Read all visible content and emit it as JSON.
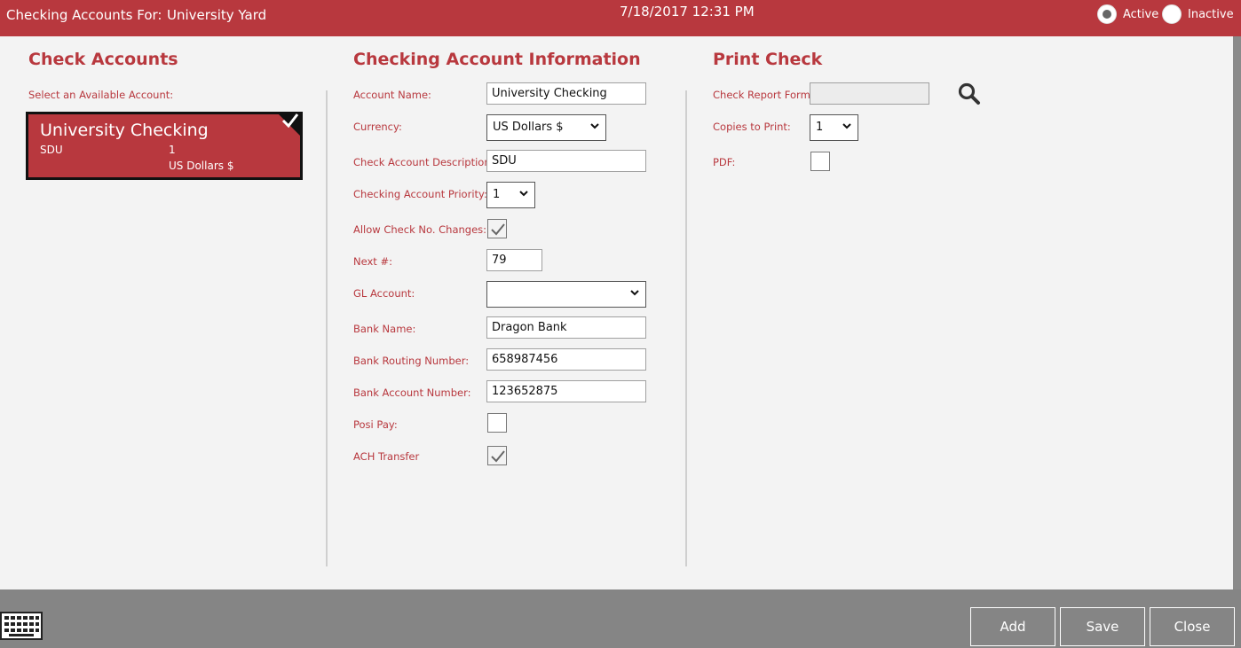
{
  "header": {
    "prefix": "Checking Accounts For:",
    "name": "University Yard",
    "datetime": "7/18/2017 12:31 PM",
    "active_label": "Active",
    "inactive_label": "Inactive",
    "active_selected": true
  },
  "check_accounts": {
    "title": "Check Accounts",
    "select_label": "Select an Available Account:",
    "account": {
      "name": "University Checking",
      "code": "SDU",
      "priority": "1",
      "currency": "US Dollars $"
    }
  },
  "info": {
    "title": "Checking Account Information",
    "account_name_label": "Account Name:",
    "account_name": "University Checking",
    "currency_label": "Currency:",
    "currency": "US Dollars $",
    "description_label": "Check Account Description:",
    "description": "SDU",
    "priority_label": "Checking Account Priority:",
    "priority": "1",
    "allow_changes_label": "Allow Check No. Changes:",
    "allow_changes": true,
    "next_label": "Next #:",
    "next": "79",
    "gl_label": "GL Account:",
    "gl": "",
    "bank_name_label": "Bank Name:",
    "bank_name": "Dragon Bank",
    "routing_label": "Bank Routing Number:",
    "routing": "658987456",
    "account_number_label": "Bank Account Number:",
    "account_number": "123652875",
    "posi_pay_label": "Posi Pay:",
    "posi_pay": false,
    "ach_label": "ACH Transfer",
    "ach": true
  },
  "print": {
    "title": "Print Check",
    "report_form_label": "Check Report Form:",
    "report_form": "",
    "copies_label": "Copies to Print:",
    "copies": "1",
    "pdf_label": "PDF:",
    "pdf": false
  },
  "footer": {
    "add": "Add",
    "save": "Save",
    "close": "Close"
  },
  "icons": {
    "search": "search-icon",
    "keyboard": "keyboard-icon",
    "check": "checkmark-icon",
    "chevron": "chevron-down-icon"
  },
  "colors": {
    "brand": "#b8383e",
    "footer": "#858585"
  }
}
